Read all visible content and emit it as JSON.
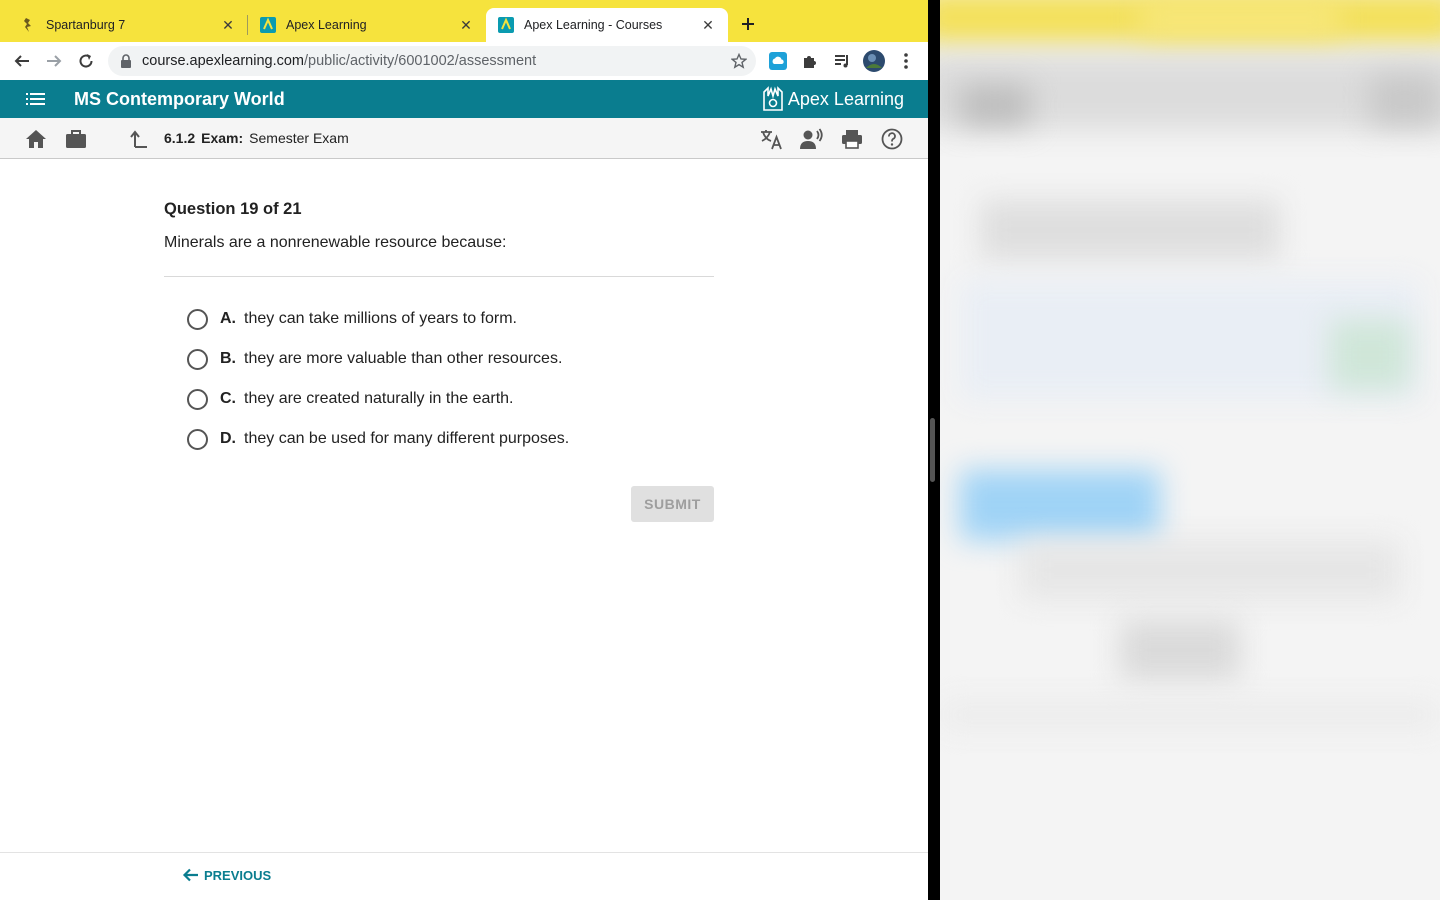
{
  "browser": {
    "tabs": [
      {
        "title": "Spartanburg 7",
        "favicon": "spartanburg-favicon"
      },
      {
        "title": "Apex Learning",
        "favicon": "apex-favicon"
      },
      {
        "title": "Apex Learning - Courses",
        "favicon": "apex-favicon",
        "active": true
      }
    ],
    "url_host": "course.apexlearning.com",
    "url_path": "/public/activity/6001002/assessment"
  },
  "app": {
    "course_title": "MS Contemporary World",
    "brand": "Apex Learning",
    "accent_color": "#0a7d8f"
  },
  "breadcrumb": {
    "number": "6.1.2",
    "kind": "Exam:",
    "title": "Semester Exam"
  },
  "question": {
    "counter": "Question 19 of 21",
    "prompt": "Minerals are a nonrenewable resource because:",
    "options": [
      {
        "letter": "A.",
        "text": "they can take millions of years to form."
      },
      {
        "letter": "B.",
        "text": "they are more valuable than other resources."
      },
      {
        "letter": "C.",
        "text": "they are created naturally in the earth."
      },
      {
        "letter": "D.",
        "text": "they can be used for many different purposes."
      }
    ],
    "submit_label": "SUBMIT"
  },
  "footer": {
    "previous_label": "PREVIOUS"
  }
}
